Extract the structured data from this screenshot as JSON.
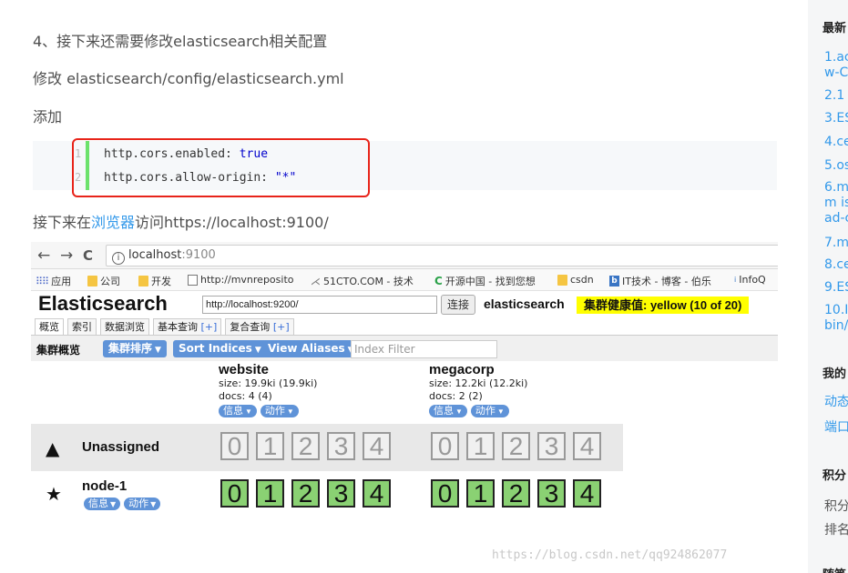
{
  "article": {
    "step_line": "4、接下来还需要修改elasticsearch相关配置",
    "modify_line": "修改 elasticsearch/config/elasticsearch.yml",
    "add_line": "添加",
    "visit_prefix": "接下来在",
    "visit_link": "浏览器",
    "visit_suffix": "访问https://localhost:9100/"
  },
  "code": {
    "lines": [
      {
        "num": "1",
        "key": "http.cors.enabled: ",
        "value": "true"
      },
      {
        "num": "2",
        "key": "http.cors.allow-origin: ",
        "value": "\"*\""
      }
    ],
    "highlight_color": "#e8241a"
  },
  "browser": {
    "back": "←",
    "forward": "→",
    "reload": "C",
    "url_host": "localhost",
    "url_port": ":9100",
    "bookmarks": [
      "应用",
      "公司",
      "开发",
      "http://mvnreposito",
      "51CTO.COM - 技术",
      "开源中国 - 找到您想",
      "csdn",
      "IT技术 - 博客 - 伯乐",
      "InfoQ"
    ]
  },
  "es": {
    "logo": "Elasticsearch",
    "url_value": "http://localhost:9200/",
    "connect_label": "连接",
    "cluster_name": "elasticsearch",
    "health": "集群健康值: yellow (10 of 20)",
    "health_color": "#ffff00",
    "tabs": [
      {
        "label": "概览",
        "plus": ""
      },
      {
        "label": "索引",
        "plus": ""
      },
      {
        "label": "数据浏览",
        "plus": ""
      },
      {
        "label": "基本查询 ",
        "plus": "[+]"
      },
      {
        "label": "复合查询 ",
        "plus": "[+]"
      }
    ],
    "toolbar": {
      "title": "集群概览",
      "sort_cluster": "集群排序",
      "sort_indices": "Sort Indices",
      "view_aliases": "View Aliases",
      "filter_placeholder": "Index Filter"
    },
    "indices": [
      {
        "name": "website",
        "size": "size: 19.9ki (19.9ki)",
        "docs": "docs: 4 (4)",
        "info": "信息",
        "action": "动作"
      },
      {
        "name": "megacorp",
        "size": "size: 12.2ki (12.2ki)",
        "docs": "docs: 2 (2)",
        "info": "信息",
        "action": "动作"
      }
    ],
    "rows": {
      "unassigned_label": "Unassigned",
      "node_label": "node-1",
      "node_info": "信息",
      "node_action": "动作",
      "shards": [
        "0",
        "1",
        "2",
        "3",
        "4"
      ]
    },
    "shard_ok_color": "#8ad173"
  },
  "watermark": "https://blog.csdn.net/qq924862077",
  "sidebar": {
    "recent_heading": "最新",
    "links": [
      "1.ac",
      "w-C",
      "2.1",
      "3.ES",
      "4.ce",
      "5.os",
      "6.m",
      "m is",
      "ad-c",
      "7.m",
      "8.ce",
      "9.ES",
      "10.I",
      "bin/"
    ],
    "mine_heading": "我的",
    "mine_links": [
      "动态",
      "端口"
    ],
    "points_heading": "积分",
    "points_texts": [
      "积分",
      "排名"
    ],
    "bottom_heading": "随笔"
  }
}
